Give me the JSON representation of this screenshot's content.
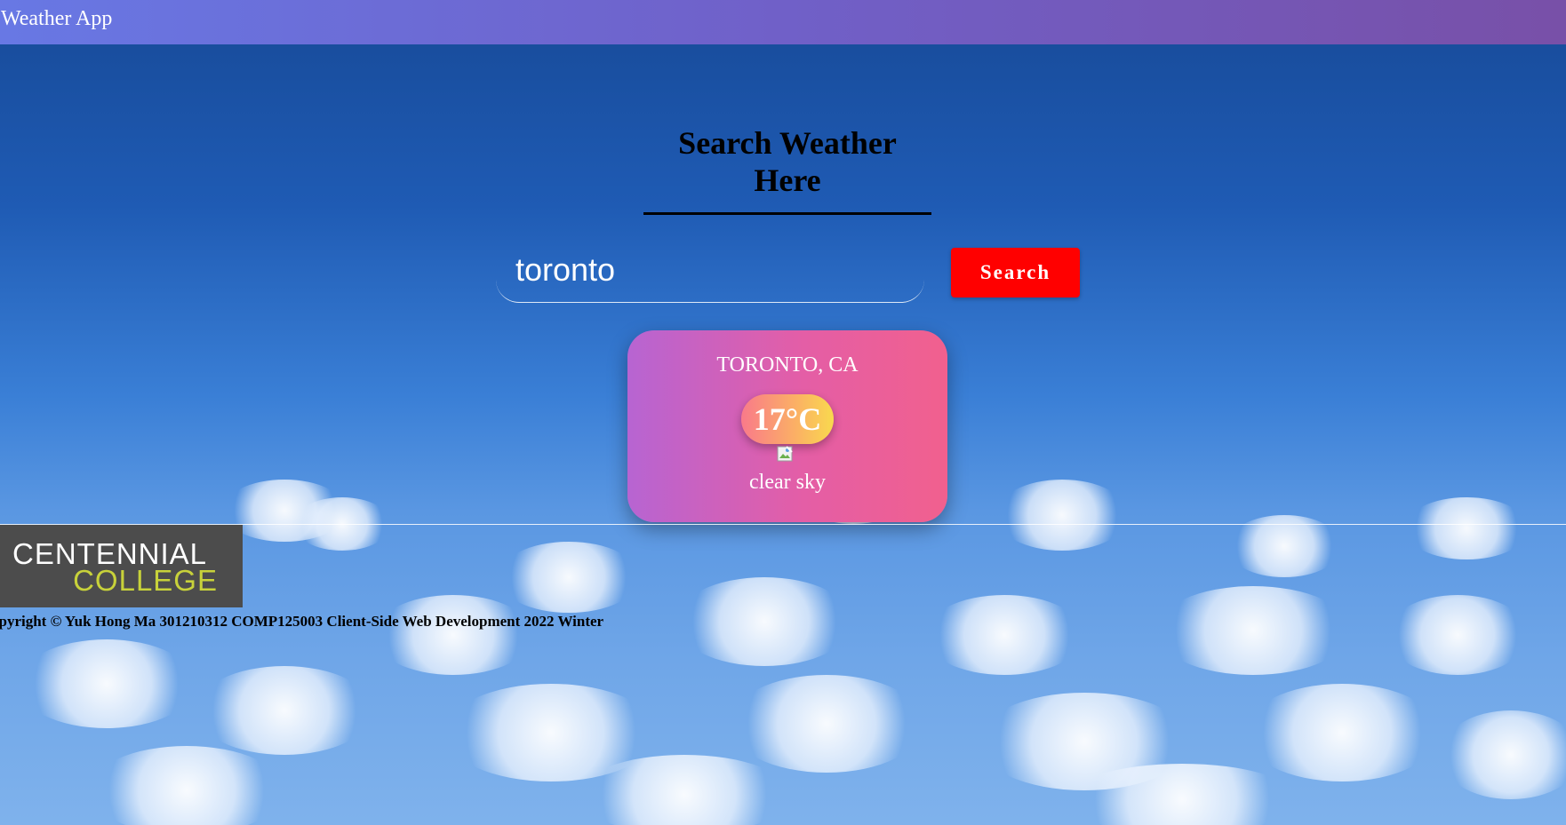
{
  "navbar": {
    "title": "Weather App"
  },
  "search": {
    "heading": "Search Weather Here",
    "input_value": "toronto",
    "button_label": "Search"
  },
  "weather_card": {
    "location": "TORONTO, CA",
    "temperature": "17°C",
    "description": "clear sky",
    "icon": "broken-image-icon"
  },
  "footer": {
    "logo_line1": "CENTENNIAL",
    "logo_line2": "COLLEGE",
    "copyright": "opyright ©  Yuk Hong Ma 301210312 COMP125003 Client-Side Web Development 2022 Winter"
  },
  "colors": {
    "navbar_start": "#6878e4",
    "navbar_end": "#7850a8",
    "search_button": "#ff0000",
    "card_start": "#b764d2",
    "card_end": "#f1608e",
    "logo_background": "#4c4c4c",
    "logo_accent": "#c8d23a"
  }
}
